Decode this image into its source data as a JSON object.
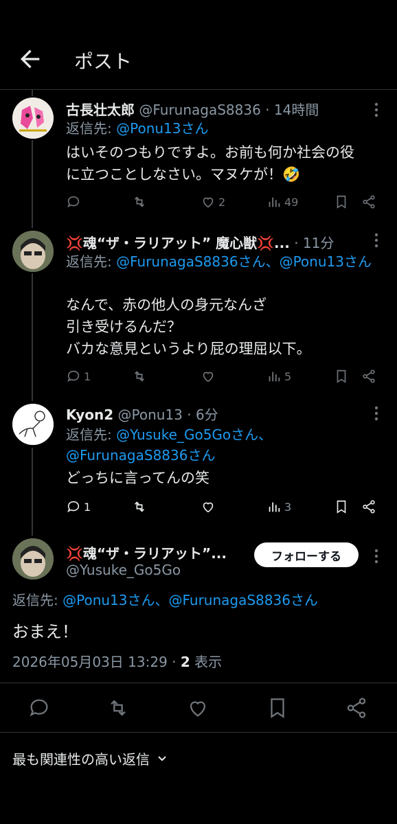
{
  "header": {
    "title": "ポスト"
  },
  "tweets": [
    {
      "name": "古長壮太郎",
      "handle": "@FurunagaS8836",
      "time": "· 14時間",
      "replying_prefix": "返信先: ",
      "replying_mentions": "@Ponu13さん",
      "body": [
        "はいそのつもりですよ。お前も何か社会の役",
        "に立つことしなさい。マヌケが！🤣"
      ],
      "replies": "",
      "likes": "2",
      "views": "49"
    },
    {
      "name": "💢魂“ザ・ラリアット” 魔心獣💢...",
      "handle": "",
      "time": "· 11分",
      "replying_prefix": "返信先: ",
      "replying_mentions": "@FurunagaS8836さん、@Ponu13さん",
      "body": [
        "なんで、赤の他人の身元なんざ",
        "引き受けるんだ？",
        "バカな意見というより屁の理屈以下。"
      ],
      "replies": "1",
      "likes": "",
      "views": "5"
    },
    {
      "name": "Kyon2",
      "handle": "@Ponu13",
      "time": "· 6分",
      "replying_prefix": "返信先: ",
      "replying_mentions": "@Yusuke_Go5Goさん、@FurunagaS8836さん",
      "body": [
        "どっちに言ってんの笑"
      ],
      "replies": "1",
      "likes": "",
      "views": "3"
    }
  ],
  "main_post": {
    "name": "💢魂“ザ・ラリアット”...",
    "handle": "@Yusuke_Go5Go",
    "follow_label": "フォローする",
    "replying_prefix": "返信先: ",
    "replying_mentions": "@Ponu13さん、@FurunagaS8836さん",
    "body": "おまえ！",
    "timestamp": "2026年05月03日 13:29 · ",
    "view_count": "2",
    "view_label": " 表示"
  },
  "related_label": "最も関連性の高い返信",
  "colors": {
    "background": "#000000",
    "text": "#e7e9ea",
    "muted": "#8b98a5",
    "accent": "#1d9bf0"
  },
  "icons": [
    "back-arrow-icon",
    "reply-icon",
    "retweet-icon",
    "like-icon",
    "views-icon",
    "bookmark-icon",
    "share-icon",
    "more-icon",
    "chevron-down-icon"
  ]
}
